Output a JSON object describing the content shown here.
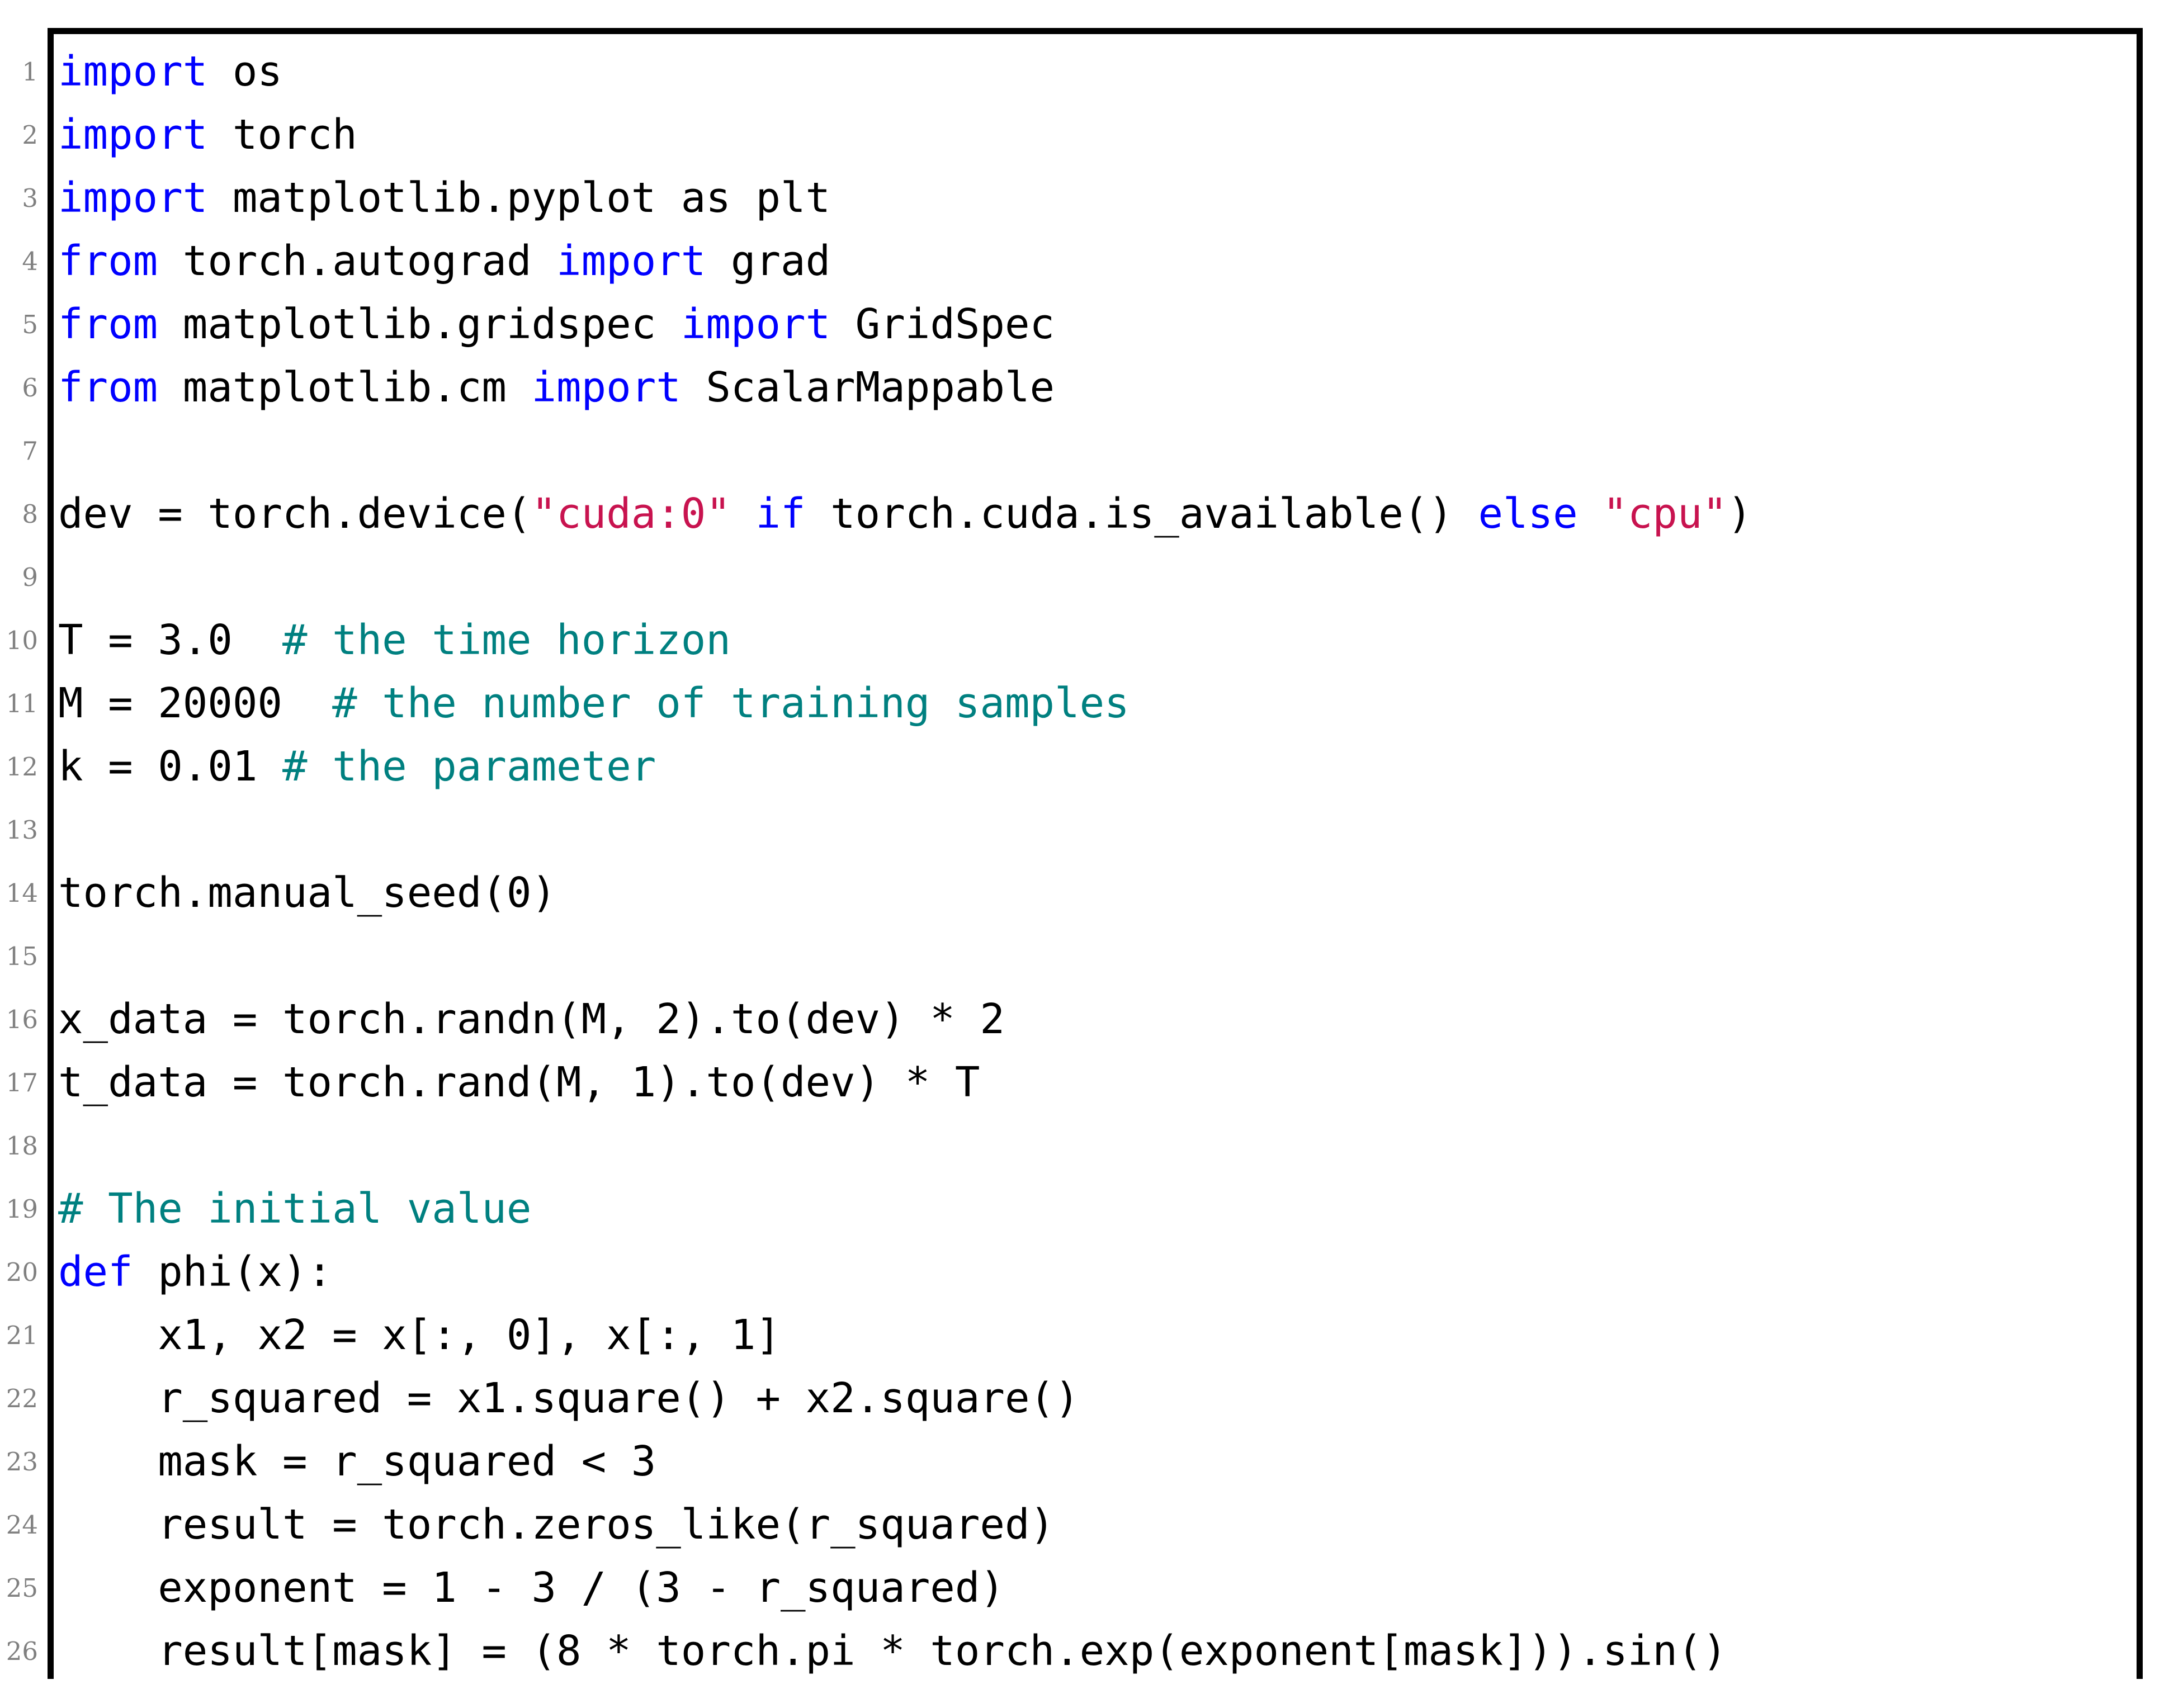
{
  "listing": {
    "language": "Python",
    "colors": {
      "keyword": "#0000ff",
      "string": "#c8134f",
      "comment": "#008080",
      "text": "#000000",
      "line_number": "#808080",
      "frame": "#000000",
      "background": "#ffffff"
    },
    "first_line_number": 1,
    "last_line_number": 26,
    "lines": [
      {
        "n": "1",
        "tokens": [
          {
            "t": "import",
            "c": "kw"
          },
          {
            "t": " os",
            "c": "plain"
          }
        ]
      },
      {
        "n": "2",
        "tokens": [
          {
            "t": "import",
            "c": "kw"
          },
          {
            "t": " torch",
            "c": "plain"
          }
        ]
      },
      {
        "n": "3",
        "tokens": [
          {
            "t": "import",
            "c": "kw"
          },
          {
            "t": " matplotlib.pyplot as plt",
            "c": "plain"
          }
        ]
      },
      {
        "n": "4",
        "tokens": [
          {
            "t": "from",
            "c": "kw"
          },
          {
            "t": " torch.autograd ",
            "c": "plain"
          },
          {
            "t": "import",
            "c": "kw"
          },
          {
            "t": " grad",
            "c": "plain"
          }
        ]
      },
      {
        "n": "5",
        "tokens": [
          {
            "t": "from",
            "c": "kw"
          },
          {
            "t": " matplotlib.gridspec ",
            "c": "plain"
          },
          {
            "t": "import",
            "c": "kw"
          },
          {
            "t": " GridSpec",
            "c": "plain"
          }
        ]
      },
      {
        "n": "6",
        "tokens": [
          {
            "t": "from",
            "c": "kw"
          },
          {
            "t": " matplotlib.cm ",
            "c": "plain"
          },
          {
            "t": "import",
            "c": "kw"
          },
          {
            "t": " ScalarMappable",
            "c": "plain"
          }
        ]
      },
      {
        "n": "7",
        "tokens": []
      },
      {
        "n": "8",
        "tokens": [
          {
            "t": "dev = torch.device(",
            "c": "plain"
          },
          {
            "t": "\"cuda:0\"",
            "c": "str"
          },
          {
            "t": " ",
            "c": "plain"
          },
          {
            "t": "if",
            "c": "kw"
          },
          {
            "t": " torch.cuda.is_available() ",
            "c": "plain"
          },
          {
            "t": "else",
            "c": "kw"
          },
          {
            "t": " ",
            "c": "plain"
          },
          {
            "t": "\"cpu\"",
            "c": "str"
          },
          {
            "t": ")",
            "c": "plain"
          }
        ]
      },
      {
        "n": "9",
        "tokens": []
      },
      {
        "n": "10",
        "tokens": [
          {
            "t": "T = 3.0  ",
            "c": "plain"
          },
          {
            "t": "# the time horizon",
            "c": "cmt"
          }
        ]
      },
      {
        "n": "11",
        "tokens": [
          {
            "t": "M = 20000  ",
            "c": "plain"
          },
          {
            "t": "# the number of training samples",
            "c": "cmt"
          }
        ]
      },
      {
        "n": "12",
        "tokens": [
          {
            "t": "k = 0.01 ",
            "c": "plain"
          },
          {
            "t": "# the parameter",
            "c": "cmt"
          }
        ]
      },
      {
        "n": "13",
        "tokens": []
      },
      {
        "n": "14",
        "tokens": [
          {
            "t": "torch.manual_seed(0)",
            "c": "plain"
          }
        ]
      },
      {
        "n": "15",
        "tokens": []
      },
      {
        "n": "16",
        "tokens": [
          {
            "t": "x_data = torch.randn(M, 2).to(dev) * 2",
            "c": "plain"
          }
        ]
      },
      {
        "n": "17",
        "tokens": [
          {
            "t": "t_data = torch.rand(M, 1).to(dev) * T",
            "c": "plain"
          }
        ]
      },
      {
        "n": "18",
        "tokens": []
      },
      {
        "n": "19",
        "tokens": [
          {
            "t": "# The initial value",
            "c": "cmt"
          }
        ]
      },
      {
        "n": "20",
        "tokens": [
          {
            "t": "def",
            "c": "kw"
          },
          {
            "t": " phi(x):",
            "c": "plain"
          }
        ]
      },
      {
        "n": "21",
        "tokens": [
          {
            "t": "    x1, x2 = x[:, 0], x[:, 1]",
            "c": "plain"
          }
        ]
      },
      {
        "n": "22",
        "tokens": [
          {
            "t": "    r_squared = x1.square() + x2.square()",
            "c": "plain"
          }
        ]
      },
      {
        "n": "23",
        "tokens": [
          {
            "t": "    mask = r_squared < 3",
            "c": "plain"
          }
        ]
      },
      {
        "n": "24",
        "tokens": [
          {
            "t": "    result = torch.zeros_like(r_squared)",
            "c": "plain"
          }
        ]
      },
      {
        "n": "25",
        "tokens": [
          {
            "t": "    exponent = 1 - 3 / (3 - r_squared)",
            "c": "plain"
          }
        ]
      },
      {
        "n": "26",
        "tokens": [
          {
            "t": "    result[mask] = (8 * torch.pi * torch.exp(exponent[mask])).sin()",
            "c": "plain"
          }
        ]
      }
    ]
  }
}
